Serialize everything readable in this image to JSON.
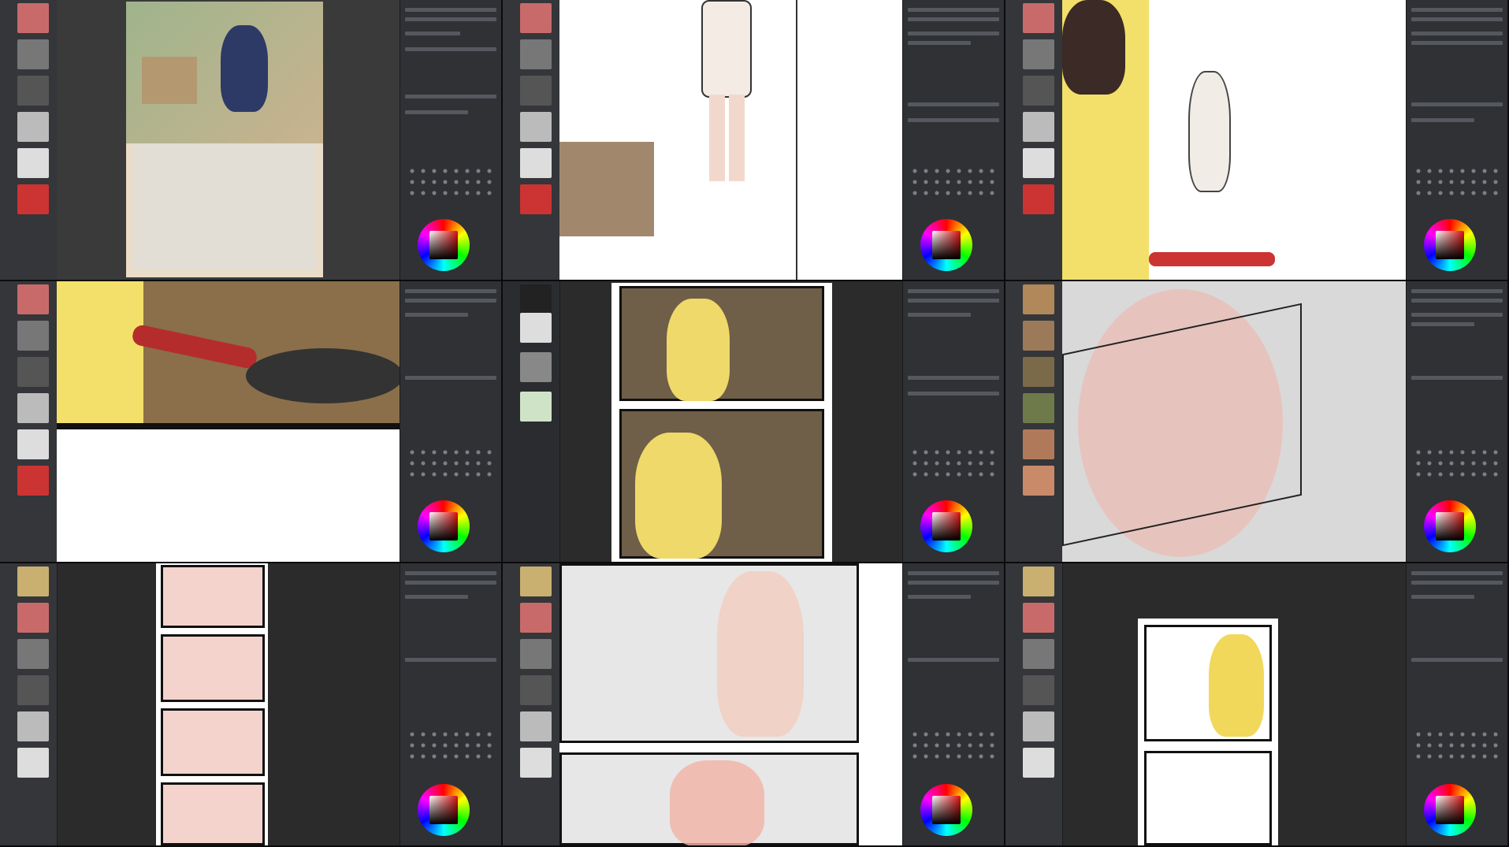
{
  "window": {
    "title": ""
  },
  "cells": [
    {
      "id": "c1",
      "scene": "full-illustration"
    },
    {
      "id": "c2",
      "scene": "girl-standing-lineart"
    },
    {
      "id": "c3",
      "scene": "cooking-wide"
    },
    {
      "id": "c4",
      "scene": "frying-pan-closeup"
    },
    {
      "id": "c5",
      "scene": "two-panel-cooking"
    },
    {
      "id": "c6",
      "scene": "3d-cabinet-guide"
    },
    {
      "id": "c7",
      "scene": "3d-mannequin-pages"
    },
    {
      "id": "c8",
      "scene": "mannequin-sketch"
    },
    {
      "id": "c9",
      "scene": "panel-finished"
    }
  ],
  "colors": {
    "ui_dark": "#2f3135",
    "canvas_bg": "#3a3a3a",
    "accent": "#d11"
  },
  "icons": [
    "material-thumb-icon",
    "brush-preview-icon",
    "color-wheel-icon"
  ]
}
